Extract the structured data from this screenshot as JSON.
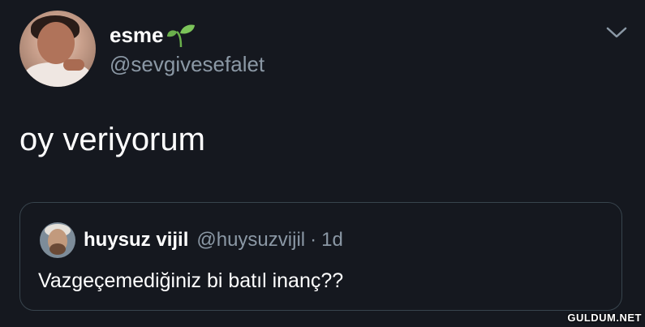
{
  "tweet": {
    "display_name": "esme",
    "handle": "@sevgivesefalet",
    "text": "oy veriyorum"
  },
  "quoted": {
    "display_name": "huysuz vijil",
    "handle": "@huysuzvijil",
    "separator": "·",
    "time": "1d",
    "text": "Vazgeçemediğiniz bi batıl inanç??"
  },
  "watermark": "GULDUM.NET",
  "colors": {
    "background": "#15181f",
    "text_primary": "#ffffff",
    "text_secondary": "#8b98a5",
    "border": "#38444d",
    "sprout": "#6ab04c"
  },
  "icons": {
    "name_emoji": "seedling-icon",
    "menu": "chevron-down-icon"
  }
}
